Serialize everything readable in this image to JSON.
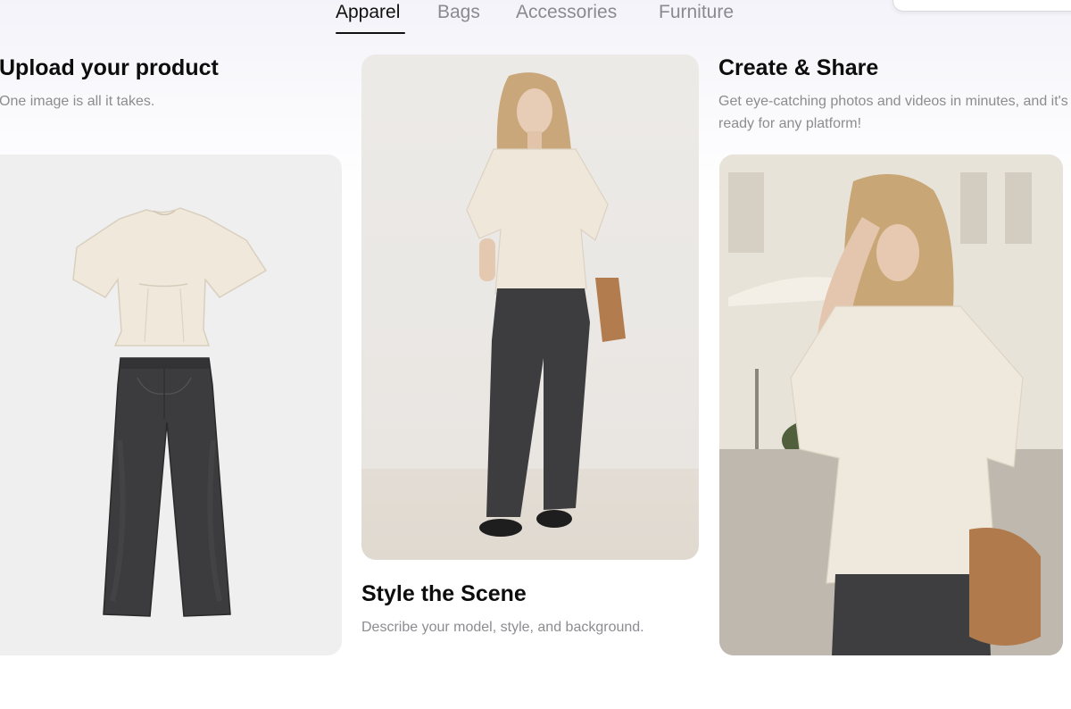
{
  "tabs": [
    {
      "label": "Apparel",
      "active": true
    },
    {
      "label": "Bags",
      "active": false
    },
    {
      "label": "Accessories",
      "active": false
    },
    {
      "label": "Furniture",
      "active": false
    }
  ],
  "steps": [
    {
      "title": "Upload your product",
      "description": "One image is all it takes."
    },
    {
      "title": "Style the Scene",
      "description": "Describe your model, style, and background."
    },
    {
      "title": "Create & Share",
      "description": "Get eye-catching photos and videos in minutes, and it's ready for any platform!"
    }
  ],
  "colors": {
    "text_primary": "#111111",
    "text_muted": "#8a8a8f",
    "card_background": "#efefef",
    "blouse": "#eee6d8",
    "jeans": "#3b3b3c",
    "bag": "#b07a4c"
  }
}
